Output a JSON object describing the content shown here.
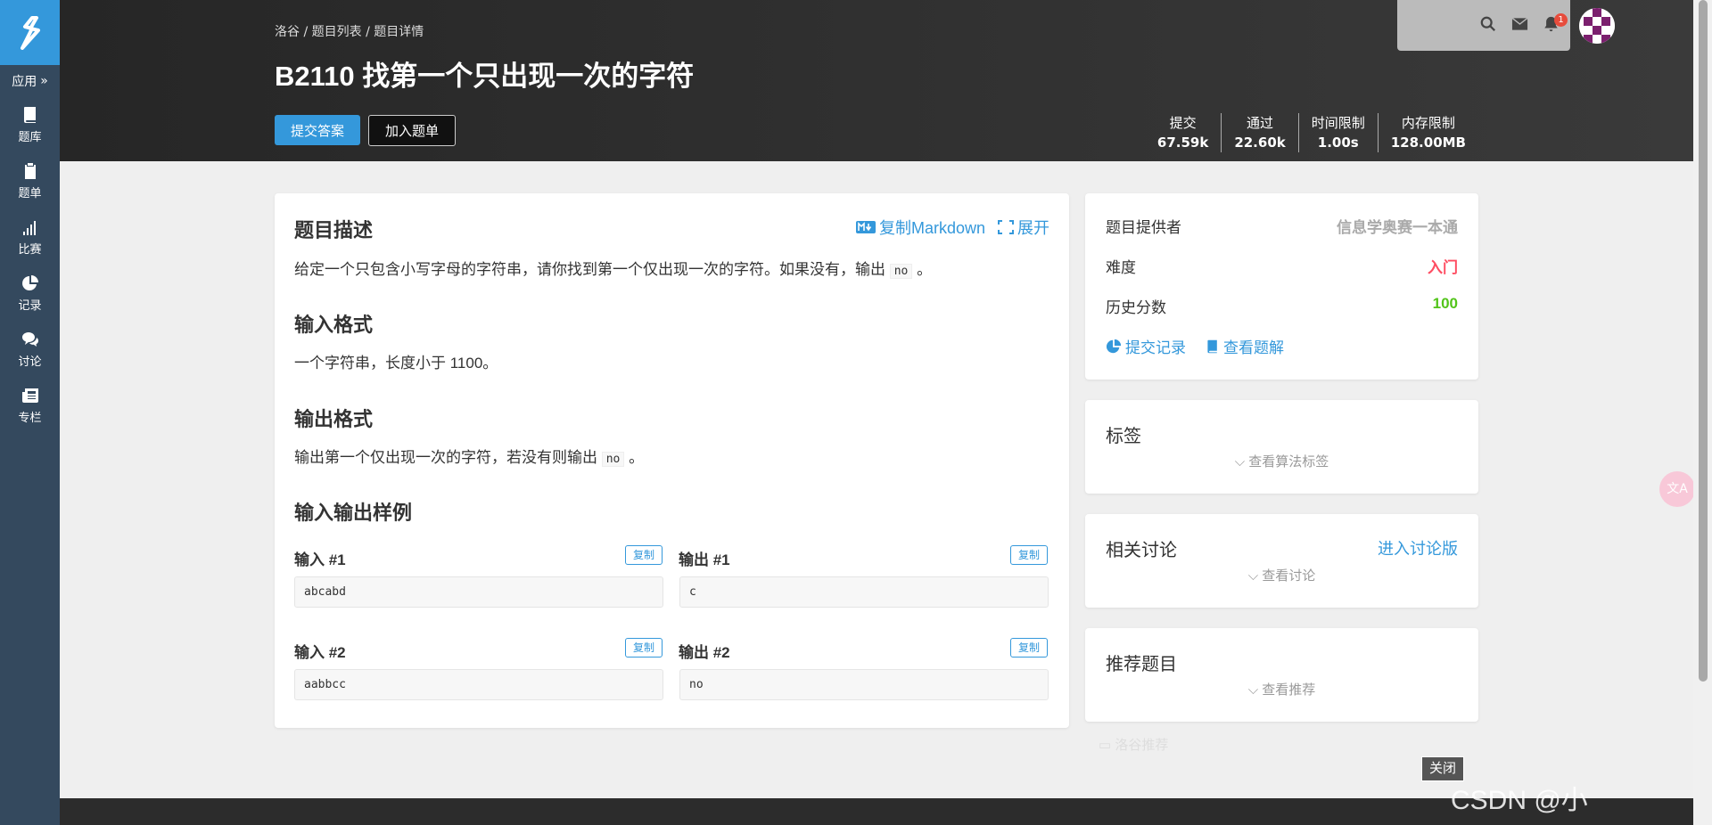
{
  "sidebar": {
    "app_label": "应用",
    "items": [
      {
        "label": "题库",
        "icon": "book-icon"
      },
      {
        "label": "题单",
        "icon": "clipboard-icon"
      },
      {
        "label": "比赛",
        "icon": "bar-chart-icon"
      },
      {
        "label": "记录",
        "icon": "pie-chart-icon"
      },
      {
        "label": "讨论",
        "icon": "comments-icon"
      },
      {
        "label": "专栏",
        "icon": "newspaper-icon"
      }
    ]
  },
  "header": {
    "breadcrumb": "洛谷 / 题目列表 / 题目详情",
    "title": "B2110 找第一个只出现一次的字符",
    "submit_label": "提交答案",
    "add_label": "加入题单",
    "stats": [
      {
        "label": "提交",
        "value": "67.59k"
      },
      {
        "label": "通过",
        "value": "22.60k"
      },
      {
        "label": "时间限制",
        "value": "1.00s"
      },
      {
        "label": "内存限制",
        "value": "128.00MB"
      }
    ],
    "notification_count": "1"
  },
  "problem": {
    "desc_title": "题目描述",
    "copy_markdown": "复制Markdown",
    "expand": "展开",
    "desc_text_before": "给定一个只包含小写字母的字符串，请你找到第一个仅出现一次的字符。如果没有，输出",
    "desc_code": "no",
    "desc_text_after": "。",
    "input_title": "输入格式",
    "input_text": "一个字符串，长度小于 1100。",
    "output_title": "输出格式",
    "output_text_before": "输出第一个仅出现一次的字符，若没有则输出",
    "output_code": "no",
    "output_text_after": "。",
    "samples_title": "输入输出样例",
    "copy_label": "复制",
    "samples": [
      {
        "in_label": "输入 #1",
        "in": "abcabd",
        "out_label": "输出 #1",
        "out": "c"
      },
      {
        "in_label": "输入 #2",
        "in": "aabbcc",
        "out_label": "输出 #2",
        "out": "no"
      }
    ]
  },
  "info": {
    "provider_label": "题目提供者",
    "provider": "信息学奥赛一本通",
    "difficulty_label": "难度",
    "difficulty": "入门",
    "score_label": "历史分数",
    "score": "100",
    "records_link": "提交记录",
    "solution_link": "查看题解",
    "difficulty_color": "#fe4c61",
    "score_color": "#52c41a"
  },
  "tags": {
    "title": "标签",
    "expand": "查看算法标签"
  },
  "discuss": {
    "title": "相关讨论",
    "enter": "进入讨论版",
    "expand": "查看讨论"
  },
  "recommend": {
    "title": "推荐题目",
    "expand": "查看推荐"
  },
  "misc": {
    "luogu_recommend": "洛谷推荐",
    "close": "关闭",
    "watermark": "CSDN @小",
    "translate": "文A"
  }
}
